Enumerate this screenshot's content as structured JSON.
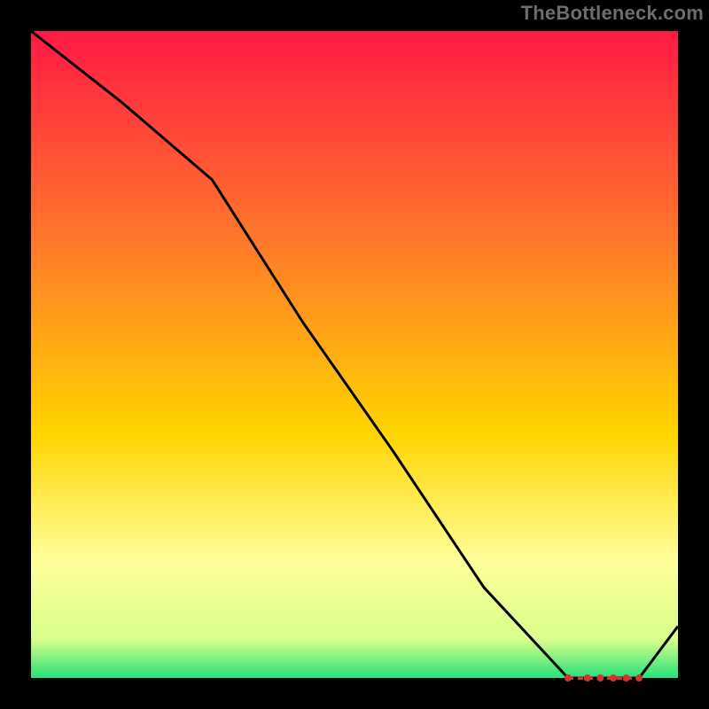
{
  "watermark": "TheBottleneck.com",
  "colors": {
    "bg": "#000000",
    "top": "#ff1a44",
    "mid_upper": "#ff7a2a",
    "mid": "#ffd400",
    "lower": "#ffff9a",
    "bottom": "#28e07a",
    "line": "#000000",
    "marker": "#d2352f"
  },
  "chart_data": {
    "type": "line",
    "title": "",
    "xlabel": "",
    "ylabel": "",
    "xlim": [
      0,
      1
    ],
    "ylim": [
      0,
      1
    ],
    "grid": false,
    "legend": false,
    "note": "Axes are unlabeled; values are normalized 0–1. The curve starts at the top-left, descends with a slope change near x≈0.28, reaches a flat minimum across roughly x≈0.83–0.94, then rises toward the right edge.",
    "series": [
      {
        "name": "curve",
        "x": [
          0.0,
          0.14,
          0.28,
          0.42,
          0.56,
          0.7,
          0.83,
          0.88,
          0.94,
          1.0
        ],
        "y": [
          1.0,
          0.89,
          0.77,
          0.55,
          0.35,
          0.14,
          0.0,
          0.0,
          0.0,
          0.08
        ]
      }
    ],
    "markers": {
      "name": "minimum-band",
      "x": [
        0.83,
        0.86,
        0.88,
        0.9,
        0.92,
        0.94
      ],
      "y": [
        0.0,
        0.0,
        0.0,
        0.0,
        0.0,
        0.0
      ]
    },
    "background_gradient_stops": [
      {
        "offset": 0.0,
        "color": "#ff1a44"
      },
      {
        "offset": 0.33,
        "color": "#ff7a2a"
      },
      {
        "offset": 0.62,
        "color": "#ffd400"
      },
      {
        "offset": 0.82,
        "color": "#ffff9a"
      },
      {
        "offset": 0.94,
        "color": "#d9ff8a"
      },
      {
        "offset": 1.0,
        "color": "#28e07a"
      }
    ]
  }
}
